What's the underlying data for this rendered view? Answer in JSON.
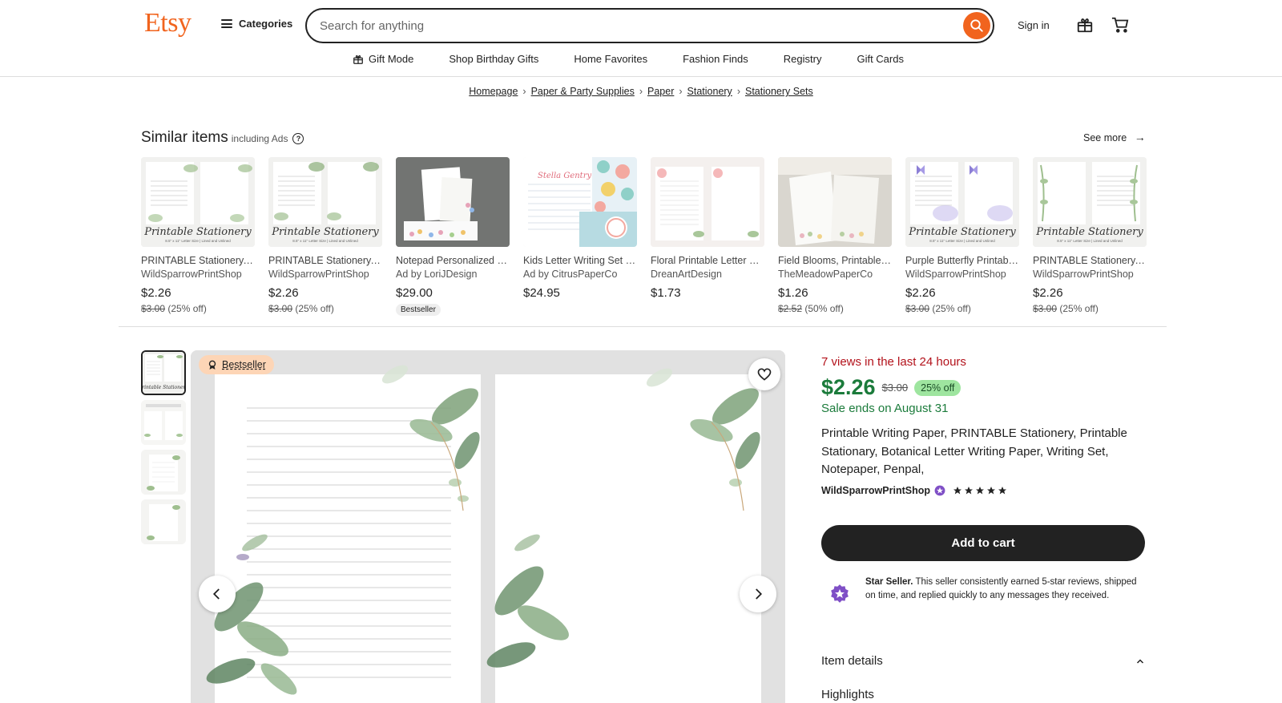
{
  "header": {
    "logo": "Etsy",
    "categories_label": "Categories",
    "search_placeholder": "Search for anything",
    "signin_label": "Sign in"
  },
  "subnav": {
    "items": [
      "Gift Mode",
      "Shop Birthday Gifts",
      "Home Favorites",
      "Fashion Finds",
      "Registry",
      "Gift Cards"
    ]
  },
  "breadcrumb": [
    "Homepage",
    "Paper & Party Supplies",
    "Paper",
    "Stationery",
    "Stationery Sets"
  ],
  "similar": {
    "title": "Similar items",
    "subtitle": "including Ads",
    "see_more": "See more",
    "cards": [
      {
        "title": "PRINTABLE Stationery, Printable Writing Paper",
        "shop": "WildSparrowPrintShop",
        "price": "$2.26",
        "orig": "$3.00",
        "off": "(25% off)",
        "thumb_text": "Printable Stationery",
        "thumb_sub": "8.5\" x 11\" Letter Size | Lined and Unlined"
      },
      {
        "title": "PRINTABLE Stationery, Printable Writing Paper",
        "shop": "WildSparrowPrintShop",
        "price": "$2.26",
        "orig": "$3.00",
        "off": "(25% off)",
        "thumb_text": "Printable Stationery",
        "thumb_sub": "8.5\" x 11\" Letter Size | Lined and Unlined"
      },
      {
        "title": "Notepad Personalized Wildflower",
        "shop": "Ad by LoriJDesign",
        "price": "$29.00",
        "badge": "Bestseller"
      },
      {
        "title": "Kids Letter Writing Set Personalized",
        "shop": "Ad by CitrusPaperCo",
        "price": "$24.95",
        "thumb_text": "Stella Gentry"
      },
      {
        "title": "Floral Printable Letter Writing Paper",
        "shop": "DreanArtDesign",
        "price": "$1.73"
      },
      {
        "title": "Field Blooms, Printable Stationery",
        "shop": "TheMeadowPaperCo",
        "price": "$1.26",
        "orig": "$2.52",
        "off": "(50% off)"
      },
      {
        "title": "Purple Butterfly Printable Stationery",
        "shop": "WildSparrowPrintShop",
        "price": "$2.26",
        "orig": "$3.00",
        "off": "(25% off)",
        "thumb_text": "Printable Stationery",
        "thumb_sub": "8.5\" x 11\" Letter Size | Lined and Unlined"
      },
      {
        "title": "PRINTABLE Stationery, Printable Writing Paper",
        "shop": "WildSparrowPrintShop",
        "price": "$2.26",
        "orig": "$3.00",
        "off": "(25% off)",
        "thumb_text": "Printable Stationery",
        "thumb_sub": "8.5\" x 11\" Letter Size | Lined and Unlined"
      }
    ]
  },
  "gallery": {
    "badge": "Bestseller"
  },
  "product": {
    "views": "7 views in the last 24 hours",
    "price": "$2.26",
    "orig_price": "$3.00",
    "discount": "25% off",
    "sale_ends": "Sale ends on August 31",
    "title": "Printable Writing Paper, PRINTABLE Stationery, Printable Stationary, Botanical Letter Writing Paper, Writing Set, Notepaper, Penpal,",
    "shop": "WildSparrowPrintShop",
    "rating_stars": 5,
    "add_to_cart": "Add to cart",
    "star_seller_label": "Star Seller.",
    "star_seller_text": " This seller consistently earned 5-star reviews, shipped on time, and replied quickly to any messages they received.",
    "item_details": "Item details",
    "highlights": "Highlights"
  },
  "colors": {
    "brand": "#f1641e",
    "price_green": "#1b7b3b",
    "views_red": "#b3121b",
    "star_seller_purple": "#7f4fc6"
  }
}
